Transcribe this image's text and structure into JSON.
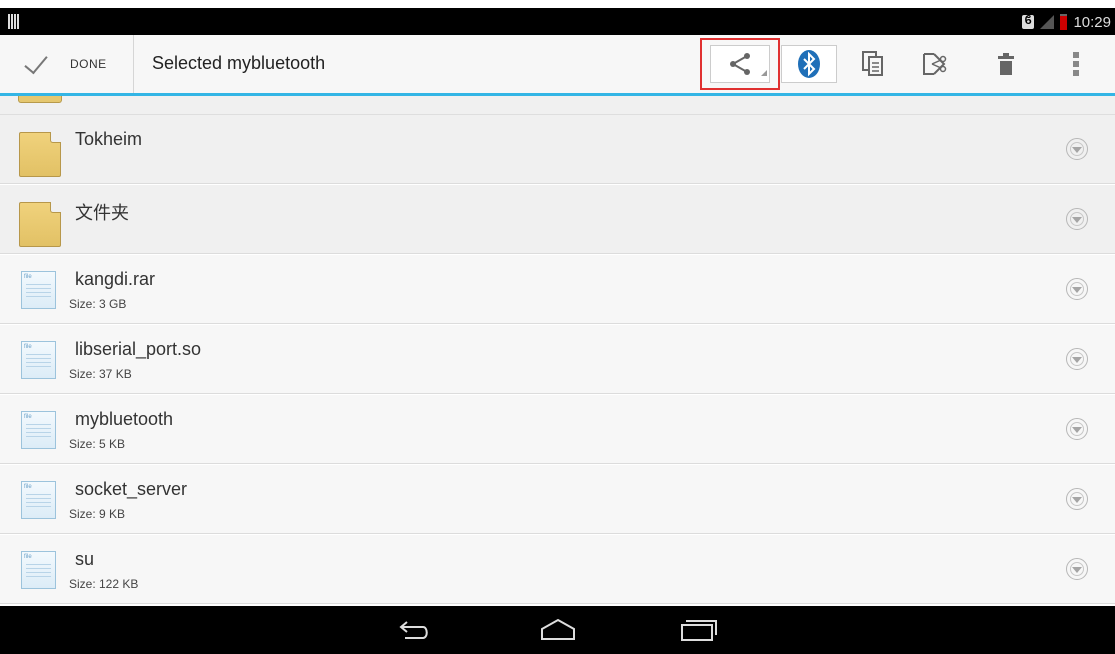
{
  "status_bar": {
    "time": "10:29",
    "icons": [
      "notification-icon",
      "bluetooth-icon",
      "signal-icon",
      "battery-icon"
    ]
  },
  "action_bar": {
    "done_label": "DONE",
    "title": "Selected mybluetooth",
    "actions": [
      "share-icon",
      "bluetooth-share-icon",
      "copy-icon",
      "cut-icon",
      "delete-icon",
      "overflow-menu-icon"
    ],
    "accent_color": "#33b5e5",
    "highlight_color": "#e03030"
  },
  "files": [
    {
      "name": "Tokheim",
      "type": "folder",
      "size": ""
    },
    {
      "name": "文件夹",
      "type": "folder",
      "size": ""
    },
    {
      "name": "kangdi.rar",
      "type": "file",
      "size": "Size: 3 GB"
    },
    {
      "name": "libserial_port.so",
      "type": "file",
      "size": "Size: 37 KB"
    },
    {
      "name": "mybluetooth",
      "type": "file",
      "size": "Size: 5 KB"
    },
    {
      "name": "socket_server",
      "type": "file",
      "size": "Size: 9 KB"
    },
    {
      "name": "su",
      "type": "file",
      "size": "Size: 122 KB"
    }
  ],
  "nav_bar": {
    "buttons": [
      "back-icon",
      "home-icon",
      "recents-icon"
    ]
  }
}
